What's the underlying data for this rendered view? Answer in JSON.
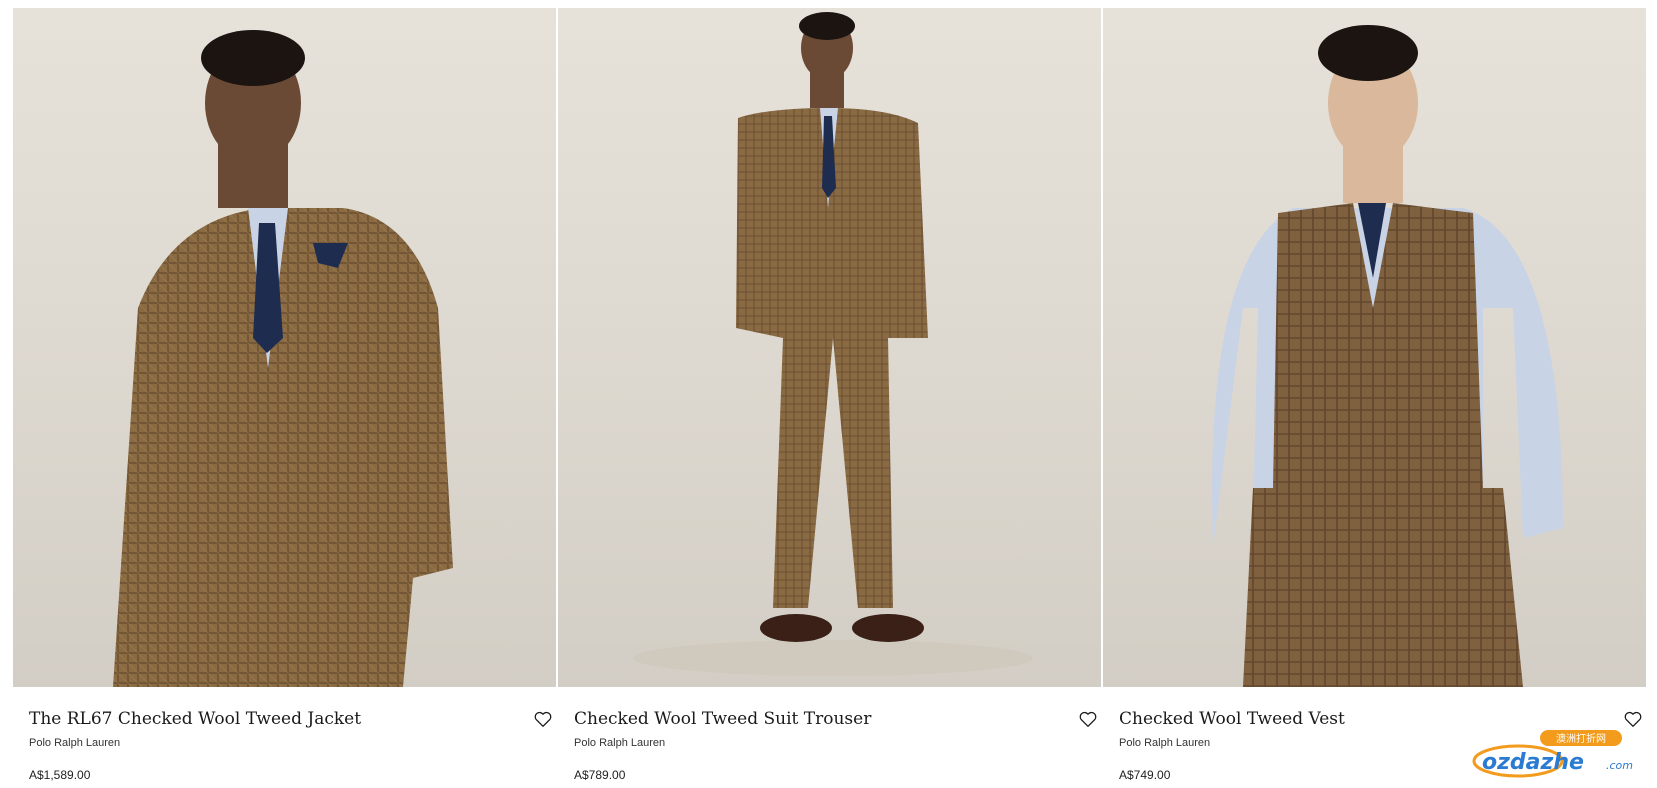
{
  "products": [
    {
      "title": "The RL67 Checked Wool Tweed Jacket",
      "brand": "Polo Ralph Lauren",
      "price": "A$1,589.00",
      "image": "model-jacket-image",
      "wishlist_icon": "heart-outline-icon"
    },
    {
      "title": "Checked Wool Tweed Suit Trouser",
      "brand": "Polo Ralph Lauren",
      "price": "A$789.00",
      "image": "model-trouser-image",
      "wishlist_icon": "heart-outline-icon"
    },
    {
      "title": "Checked Wool Tweed Vest",
      "brand": "Polo Ralph Lauren",
      "price": "A$749.00",
      "image": "model-vest-image",
      "wishlist_icon": "heart-outline-icon"
    }
  ],
  "watermark": {
    "text": "ozdazhe",
    "suffix": ".com",
    "tag": "澳洲打折网"
  },
  "colors": {
    "background": "#ffffff",
    "tweed": "#8a6a42",
    "shirt": "#c9d3e6",
    "tie": "#1e2c4f"
  }
}
